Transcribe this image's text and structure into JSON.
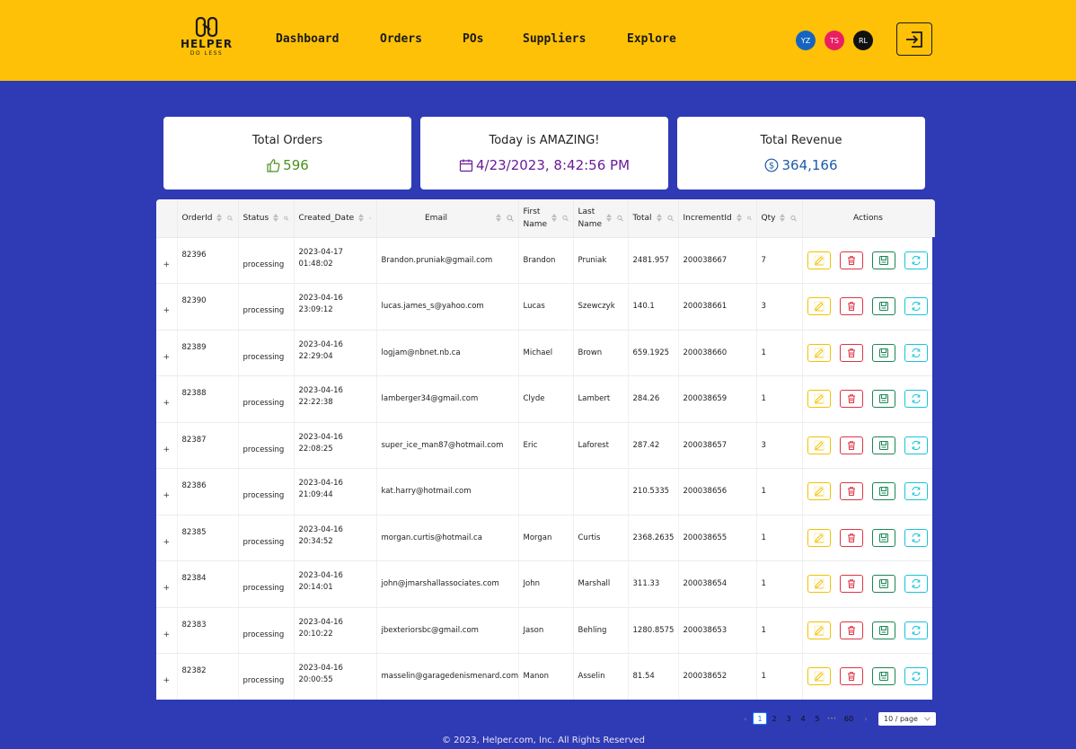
{
  "brand": {
    "name": "HELPER",
    "tagline": "DO LESS"
  },
  "nav": [
    "Dashboard",
    "Orders",
    "POs",
    "Suppliers",
    "Explore"
  ],
  "avatars": [
    {
      "initials": "YZ",
      "color": "#1565c0"
    },
    {
      "initials": "TS",
      "color": "#e91e63"
    },
    {
      "initials": "RL",
      "color": "#111111"
    }
  ],
  "cards": [
    {
      "title": "Total Orders",
      "value": "596",
      "icon": "thumbs-up-icon",
      "color": "#4a8f1c"
    },
    {
      "title": "Today is AMAZING!",
      "value": "4/23/2023, 8:42:56 PM",
      "icon": "calendar-icon",
      "color": "#6a1b9a"
    },
    {
      "title": "Total Revenue",
      "value": "364,166",
      "icon": "dollar-icon",
      "color": "#1e5aa8"
    }
  ],
  "table": {
    "columns": [
      {
        "label": "",
        "sortable": false,
        "filter": false
      },
      {
        "label": "OrderId",
        "sortable": true,
        "filter": true
      },
      {
        "label": "Status",
        "sortable": true,
        "filter": true
      },
      {
        "label": "Created_Date",
        "sortable": true,
        "filter": true
      },
      {
        "label": "Email",
        "sortable": true,
        "filter": true
      },
      {
        "label": "First Name",
        "sortable": true,
        "filter": true
      },
      {
        "label": "Last Name",
        "sortable": true,
        "filter": true
      },
      {
        "label": "Total",
        "sortable": true,
        "filter": true
      },
      {
        "label": "IncrementId",
        "sortable": true,
        "filter": true
      },
      {
        "label": "Qty",
        "sortable": true,
        "filter": true
      },
      {
        "label": "Actions",
        "sortable": false,
        "filter": false
      }
    ],
    "rows": [
      {
        "orderId": "82396",
        "status": "processing",
        "date": "2023-04-17",
        "time": "01:48:02",
        "email": "Brandon.pruniak@gmail.com",
        "first": "Brandon",
        "last": "Pruniak",
        "total": "2481.957",
        "increment": "200038667",
        "qty": "7"
      },
      {
        "orderId": "82390",
        "status": "processing",
        "date": "2023-04-16",
        "time": "23:09:12",
        "email": "lucas.james_s@yahoo.com",
        "first": "Lucas",
        "last": "Szewczyk",
        "total": "140.1",
        "increment": "200038661",
        "qty": "3"
      },
      {
        "orderId": "82389",
        "status": "processing",
        "date": "2023-04-16",
        "time": "22:29:04",
        "email": "logjam@nbnet.nb.ca",
        "first": "Michael",
        "last": "Brown",
        "total": "659.1925",
        "increment": "200038660",
        "qty": "1"
      },
      {
        "orderId": "82388",
        "status": "processing",
        "date": "2023-04-16",
        "time": "22:22:38",
        "email": "lamberger34@gmail.com",
        "first": "Clyde",
        "last": "Lambert",
        "total": "284.26",
        "increment": "200038659",
        "qty": "1"
      },
      {
        "orderId": "82387",
        "status": "processing",
        "date": "2023-04-16",
        "time": "22:08:25",
        "email": "super_ice_man87@hotmail.com",
        "first": "Eric",
        "last": "Laforest",
        "total": "287.42",
        "increment": "200038657",
        "qty": "3"
      },
      {
        "orderId": "82386",
        "status": "processing",
        "date": "2023-04-16",
        "time": "21:09:44",
        "email": "kat.harry@hotmail.com",
        "first": "",
        "last": "",
        "total": "210.5335",
        "increment": "200038656",
        "qty": "1"
      },
      {
        "orderId": "82385",
        "status": "processing",
        "date": "2023-04-16",
        "time": "20:34:52",
        "email": "morgan.curtis@hotmail.ca",
        "first": "Morgan",
        "last": "Curtis",
        "total": "2368.2635",
        "increment": "200038655",
        "qty": "1"
      },
      {
        "orderId": "82384",
        "status": "processing",
        "date": "2023-04-16",
        "time": "20:14:01",
        "email": "john@jmarshallassociates.com",
        "first": "John",
        "last": "Marshall",
        "total": "311.33",
        "increment": "200038654",
        "qty": "1"
      },
      {
        "orderId": "82383",
        "status": "processing",
        "date": "2023-04-16",
        "time": "20:10:22",
        "email": "jbexteriorsbc@gmail.com",
        "first": "Jason",
        "last": "Behling",
        "total": "1280.8575",
        "increment": "200038653",
        "qty": "1"
      },
      {
        "orderId": "82382",
        "status": "processing",
        "date": "2023-04-16",
        "time": "20:00:55",
        "email": "masselin@garagedenismenard.com",
        "first": "Manon",
        "last": "Asselin",
        "total": "81.54",
        "increment": "200038652",
        "qty": "1"
      }
    ],
    "expand_glyph": "+"
  },
  "pagination": {
    "pages": [
      "1",
      "2",
      "3",
      "4",
      "5",
      "•••",
      "60"
    ],
    "active": "1",
    "prev": "‹",
    "next": "›",
    "page_size": "10 / page"
  },
  "footer": "© 2023, Helper.com, Inc. All Rights Reserved"
}
